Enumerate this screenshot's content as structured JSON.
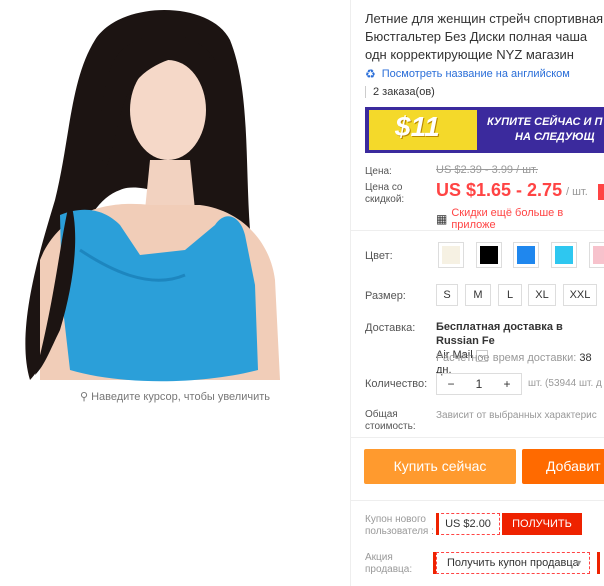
{
  "product": {
    "title": "Летние для женщин стрейч спортивная Бюстгальтер Без Диски полная чаша одн корректирующие NYZ магазин",
    "translate_link": "Посмотреть название на английском",
    "orders": "2 заказа(ов)",
    "zoom_hint": "Наведите курсор, чтобы увеличить"
  },
  "banner": {
    "price": "$11",
    "cta_line1": "КУПИТЕ СЕЙЧАС И П",
    "cta_line2": "НА СЛЕДУЮЩ"
  },
  "price": {
    "label": "Цена:",
    "old": "US $2.39 - 3.99 / шт.",
    "discount_label": "Цена со скидкой:",
    "new": "US $1.65 - 2.75",
    "unit": "/ шт.",
    "app_note": "Скидки ещё больше в приложе"
  },
  "color": {
    "label": "Цвет:",
    "swatches": [
      "#f6f1e3",
      "#000000",
      "#1f87ee",
      "#2ec7f0",
      "#f7c2cc"
    ]
  },
  "size": {
    "label": "Размер:",
    "options": [
      "S",
      "M",
      "L",
      "XL",
      "XXL"
    ]
  },
  "shipping": {
    "label": "Доставка:",
    "method_line1": "Бесплатная доставка в Russian Fe",
    "method_line2": "Air Mail",
    "estimate_label": "Расчётное время доставки:",
    "estimate_value": "38 дн."
  },
  "quantity": {
    "label": "Количество:",
    "minus": "−",
    "value": "1",
    "plus": "+",
    "unit_stock": "шт. (53944 шт. д"
  },
  "total": {
    "label": "Общая стоимость:",
    "value": "Зависит от выбранных характерис"
  },
  "actions": {
    "buy_now": "Купить сейчас",
    "add": "Добавит"
  },
  "coupons": {
    "new_user_label": "Купон нового пользователя :",
    "new_user_value": "US $2.00",
    "get_button": "ПОЛУЧИТЬ",
    "seller_label": "Акция продавца:",
    "seller_select": "Получить купон продавца"
  }
}
